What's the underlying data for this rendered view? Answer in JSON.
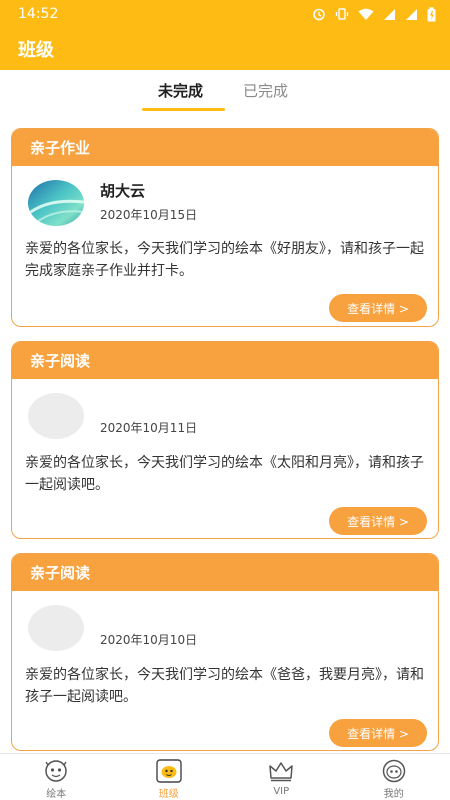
{
  "status_bar": {
    "time": "14:52"
  },
  "app_bar": {
    "title": "班级"
  },
  "tabs": [
    {
      "label": "未完成",
      "active": true
    },
    {
      "label": "已完成",
      "active": false
    }
  ],
  "cards": [
    {
      "header": "亲子作业",
      "author_name": "胡大云",
      "date": "2020年10月15日",
      "content": "亲爱的各位家长，今天我们学习的绘本《好朋友》，请和孩子一起完成家庭亲子作业并打卡。",
      "button_label": "查看详情 >"
    },
    {
      "header": "亲子阅读",
      "author_name": "",
      "date": "2020年10月11日",
      "content": "亲爱的各位家长，今天我们学习的绘本《太阳和月亮》，请和孩子一起阅读吧。",
      "button_label": "查看详情 >"
    },
    {
      "header": "亲子阅读",
      "author_name": "",
      "date": "2020年10月10日",
      "content": "亲爱的各位家长，今天我们学习的绘本《爸爸，我要月亮》，请和孩子一起阅读吧。",
      "button_label": "查看详情 >"
    }
  ],
  "bottom_nav": [
    {
      "label": "绘本",
      "icon": "picture-book-icon",
      "active": false
    },
    {
      "label": "班级",
      "icon": "class-icon",
      "active": true
    },
    {
      "label": "VIP",
      "icon": "crown-icon",
      "active": false
    },
    {
      "label": "我的",
      "icon": "profile-icon",
      "active": false
    }
  ],
  "colors": {
    "primary": "#fdbb14",
    "accent": "#f7a13f"
  }
}
